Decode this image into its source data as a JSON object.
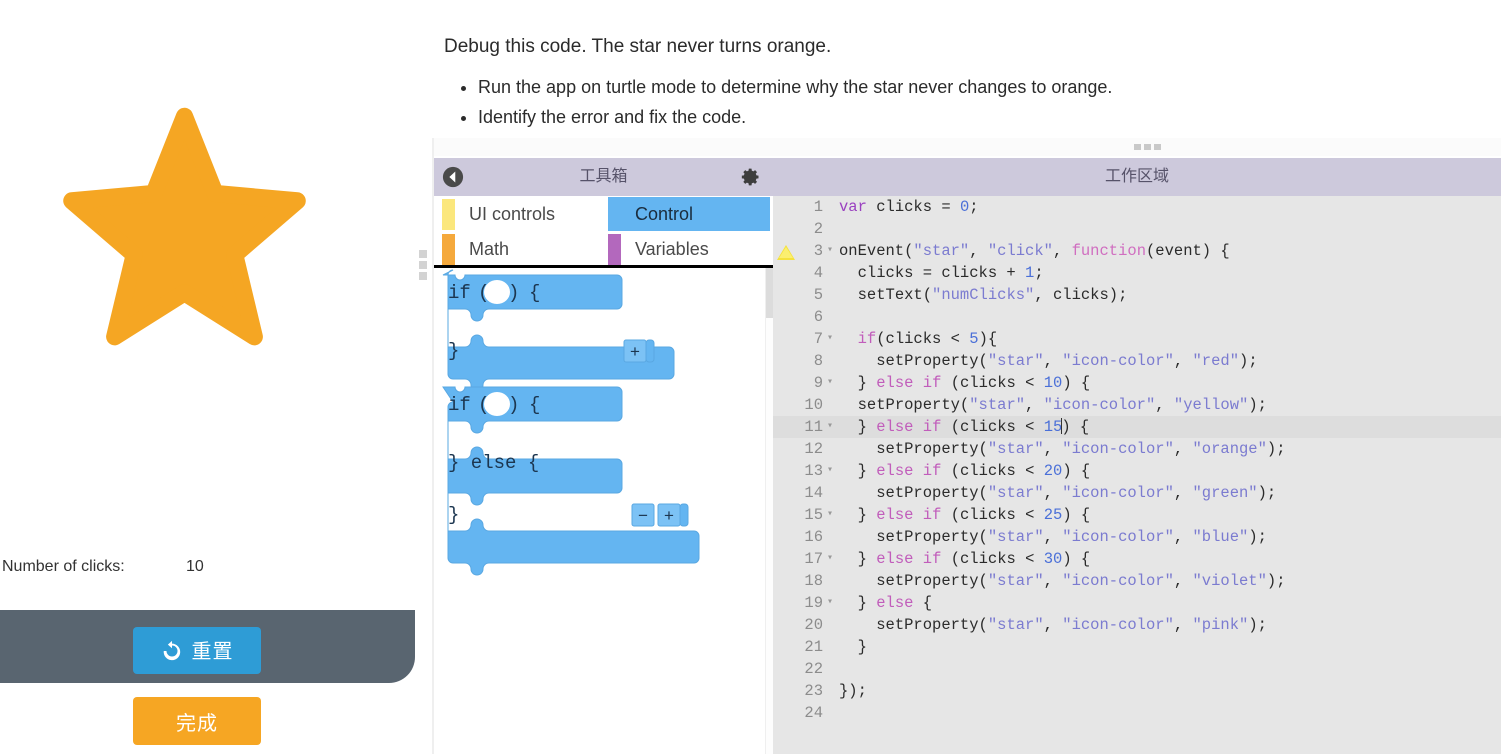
{
  "app": {
    "star_color": "#f5a623",
    "clicks_label": "Number of clicks:",
    "clicks_value": "10",
    "reset_button": "重置",
    "reset_icon": "reload-icon",
    "finish_button": "完成"
  },
  "instructions": {
    "faint_line": "",
    "title": "Debug this code. The star never turns orange.",
    "bullets": [
      "Run the app on turtle mode to determine why the star never changes to orange.",
      "Identify the error and fix the code."
    ]
  },
  "toolbox": {
    "title": "工具箱",
    "back_icon": "back-arrow-icon",
    "gear_icon": "gear-icon",
    "categories": [
      {
        "label": "UI controls",
        "color": "#fbe77c",
        "selected": false
      },
      {
        "label": "Math",
        "color": "#f5a93c",
        "selected": false
      },
      {
        "label": "Control",
        "color": "#64b5f1",
        "selected": true
      },
      {
        "label": "Variables",
        "color": "#b濃",
        "selected": false
      }
    ],
    "blocks": [
      {
        "type": "if-block",
        "header": "if ( ) {",
        "footer": "}",
        "buttons": [
          "+"
        ]
      },
      {
        "type": "if-else-block",
        "header": "if ( ) {",
        "middle": "} else {",
        "footer": "}",
        "buttons": [
          "−",
          "+"
        ]
      }
    ]
  },
  "editor": {
    "title": "工作区域",
    "active_line": 11,
    "warning_line": 3,
    "total_lines": 24,
    "lines": [
      {
        "n": "1",
        "fold": "",
        "html": "<span class='kw'>var</span> <span class='pl'>clicks</span> <span class='pl'>=</span> <span class='nu'>0</span><span class='pl'>;</span>"
      },
      {
        "n": "2",
        "fold": "",
        "html": ""
      },
      {
        "n": "3",
        "fold": "▾",
        "html": "<span class='pl'>onEvent(</span><span class='st'>\"star\"</span><span class='pl'>, </span><span class='st'>\"click\"</span><span class='pl'>, </span><span class='fn'>function</span><span class='pl'>(event) {</span>"
      },
      {
        "n": "4",
        "fold": "",
        "html": "  <span class='pl'>clicks = clicks + </span><span class='nu'>1</span><span class='pl'>;</span>"
      },
      {
        "n": "5",
        "fold": "",
        "html": "  <span class='pl'>setText(</span><span class='st'>\"numClicks\"</span><span class='pl'>, clicks);</span>"
      },
      {
        "n": "6",
        "fold": "",
        "html": ""
      },
      {
        "n": "7",
        "fold": "▾",
        "html": "  <span class='k'>if</span><span class='pl'>(clicks </span><span class='pl'>&lt;</span><span class='pl'> </span><span class='nu'>5</span><span class='pl'>){</span>"
      },
      {
        "n": "8",
        "fold": "",
        "html": "    <span class='pl'>setProperty(</span><span class='st'>\"star\"</span><span class='pl'>, </span><span class='st'>\"icon-color\"</span><span class='pl'>, </span><span class='st'>\"red\"</span><span class='pl'>);</span>"
      },
      {
        "n": "9",
        "fold": "▾",
        "html": "  <span class='pl'>}</span> <span class='k'>else</span> <span class='k'>if</span> <span class='pl'>(clicks &lt; </span><span class='nu'>10</span><span class='pl'>) {</span>"
      },
      {
        "n": "10",
        "fold": "",
        "html": "  <span class='pl'>setProperty(</span><span class='st'>\"star\"</span><span class='pl'>, </span><span class='st'>\"icon-color\"</span><span class='pl'>, </span><span class='st'>\"yellow\"</span><span class='pl'>);</span>"
      },
      {
        "n": "11",
        "fold": "▾",
        "html": "  <span class='pl'>}</span> <span class='k'>else</span> <span class='k'>if</span> <span class='pl'>(clicks &lt; </span><span class='nu'>15</span><span class='cursor'></span><span class='pl'>) {</span>"
      },
      {
        "n": "12",
        "fold": "",
        "html": "    <span class='pl'>setProperty(</span><span class='st'>\"star\"</span><span class='pl'>, </span><span class='st'>\"icon-color\"</span><span class='pl'>, </span><span class='st'>\"orange\"</span><span class='pl'>);</span>"
      },
      {
        "n": "13",
        "fold": "▾",
        "html": "  <span class='pl'>}</span> <span class='k'>else</span> <span class='k'>if</span> <span class='pl'>(clicks &lt; </span><span class='nu'>20</span><span class='pl'>) {</span>"
      },
      {
        "n": "14",
        "fold": "",
        "html": "    <span class='pl'>setProperty(</span><span class='st'>\"star\"</span><span class='pl'>, </span><span class='st'>\"icon-color\"</span><span class='pl'>, </span><span class='st'>\"green\"</span><span class='pl'>);</span>"
      },
      {
        "n": "15",
        "fold": "▾",
        "html": "  <span class='pl'>}</span> <span class='k'>else</span> <span class='k'>if</span> <span class='pl'>(clicks &lt; </span><span class='nu'>25</span><span class='pl'>) {</span>"
      },
      {
        "n": "16",
        "fold": "",
        "html": "    <span class='pl'>setProperty(</span><span class='st'>\"star\"</span><span class='pl'>, </span><span class='st'>\"icon-color\"</span><span class='pl'>, </span><span class='st'>\"blue\"</span><span class='pl'>);</span>"
      },
      {
        "n": "17",
        "fold": "▾",
        "html": "  <span class='pl'>}</span> <span class='k'>else</span> <span class='k'>if</span> <span class='pl'>(clicks &lt; </span><span class='nu'>30</span><span class='pl'>) {</span>"
      },
      {
        "n": "18",
        "fold": "",
        "html": "    <span class='pl'>setProperty(</span><span class='st'>\"star\"</span><span class='pl'>, </span><span class='st'>\"icon-color\"</span><span class='pl'>, </span><span class='st'>\"violet\"</span><span class='pl'>);</span>"
      },
      {
        "n": "19",
        "fold": "▾",
        "html": "  <span class='pl'>}</span> <span class='k'>else</span> <span class='pl'>{</span>"
      },
      {
        "n": "20",
        "fold": "",
        "html": "    <span class='pl'>setProperty(</span><span class='st'>\"star\"</span><span class='pl'>, </span><span class='st'>\"icon-color\"</span><span class='pl'>, </span><span class='st'>\"pink\"</span><span class='pl'>);</span>"
      },
      {
        "n": "21",
        "fold": "",
        "html": "  <span class='pl'>}</span>"
      },
      {
        "n": "22",
        "fold": "",
        "html": ""
      },
      {
        "n": "23",
        "fold": "",
        "html": "<span class='pl'>});</span>"
      },
      {
        "n": "24",
        "fold": "",
        "html": ""
      }
    ]
  },
  "colors": {
    "header_lavender": "#cdc9dc",
    "editor_bg": "#e6e6e6",
    "block_blue": "#64b5f1",
    "footer_dark": "#596570",
    "reset_blue": "#2e9cd6",
    "finish_orange": "#f6a623"
  }
}
